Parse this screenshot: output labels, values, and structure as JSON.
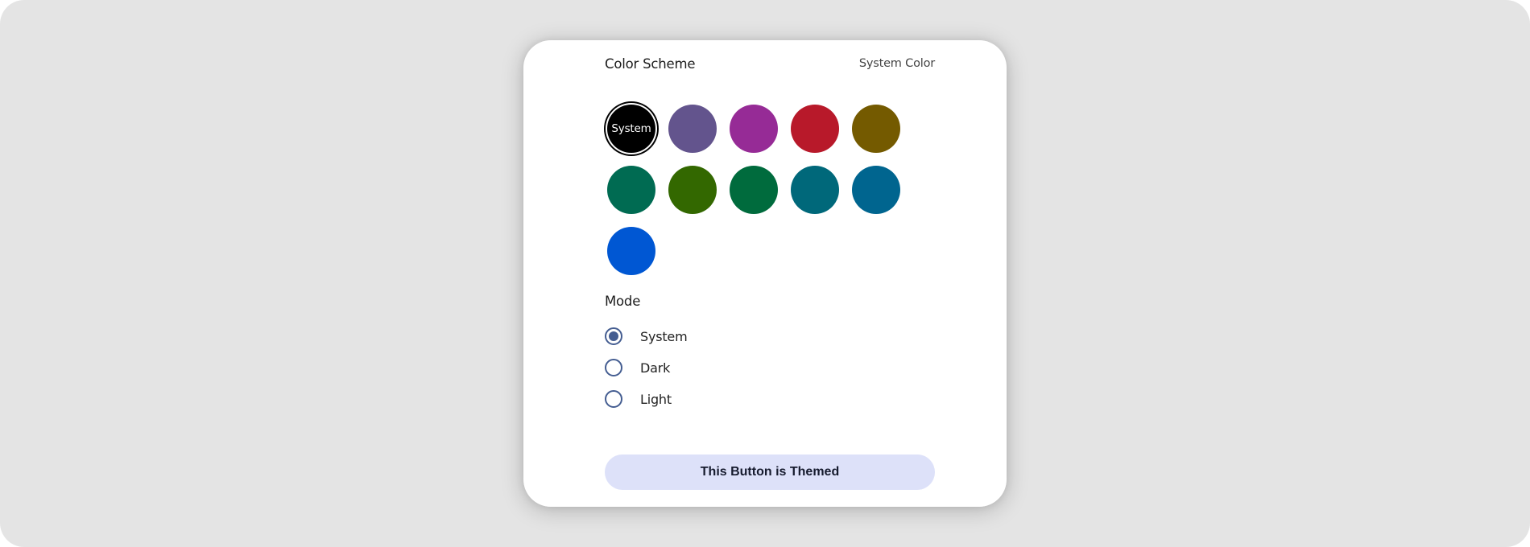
{
  "header": {
    "title": "Color Scheme",
    "current_scheme": "System Color"
  },
  "swatches": [
    {
      "name": "system",
      "label": "System",
      "color": "#000000",
      "selected": true
    },
    {
      "name": "purple",
      "label": "",
      "color": "#63548d",
      "selected": false
    },
    {
      "name": "magenta",
      "label": "",
      "color": "#962b96",
      "selected": false
    },
    {
      "name": "red",
      "label": "",
      "color": "#b8192a",
      "selected": false
    },
    {
      "name": "olive",
      "label": "",
      "color": "#745a00",
      "selected": false
    },
    {
      "name": "teal-green",
      "label": "",
      "color": "#006b52",
      "selected": false
    },
    {
      "name": "green",
      "label": "",
      "color": "#336800",
      "selected": false
    },
    {
      "name": "dark-green",
      "label": "",
      "color": "#006b3d",
      "selected": false
    },
    {
      "name": "teal",
      "label": "",
      "color": "#00687a",
      "selected": false
    },
    {
      "name": "ocean-blue",
      "label": "",
      "color": "#00658f",
      "selected": false
    },
    {
      "name": "blue",
      "label": "",
      "color": "#0057d3",
      "selected": false
    }
  ],
  "mode": {
    "title": "Mode",
    "options": [
      {
        "label": "System",
        "checked": true
      },
      {
        "label": "Dark",
        "checked": false
      },
      {
        "label": "Light",
        "checked": false
      }
    ]
  },
  "themed_button": {
    "label": "This Button is Themed",
    "color": "#dde1f9"
  },
  "accent_color": "#445d91"
}
